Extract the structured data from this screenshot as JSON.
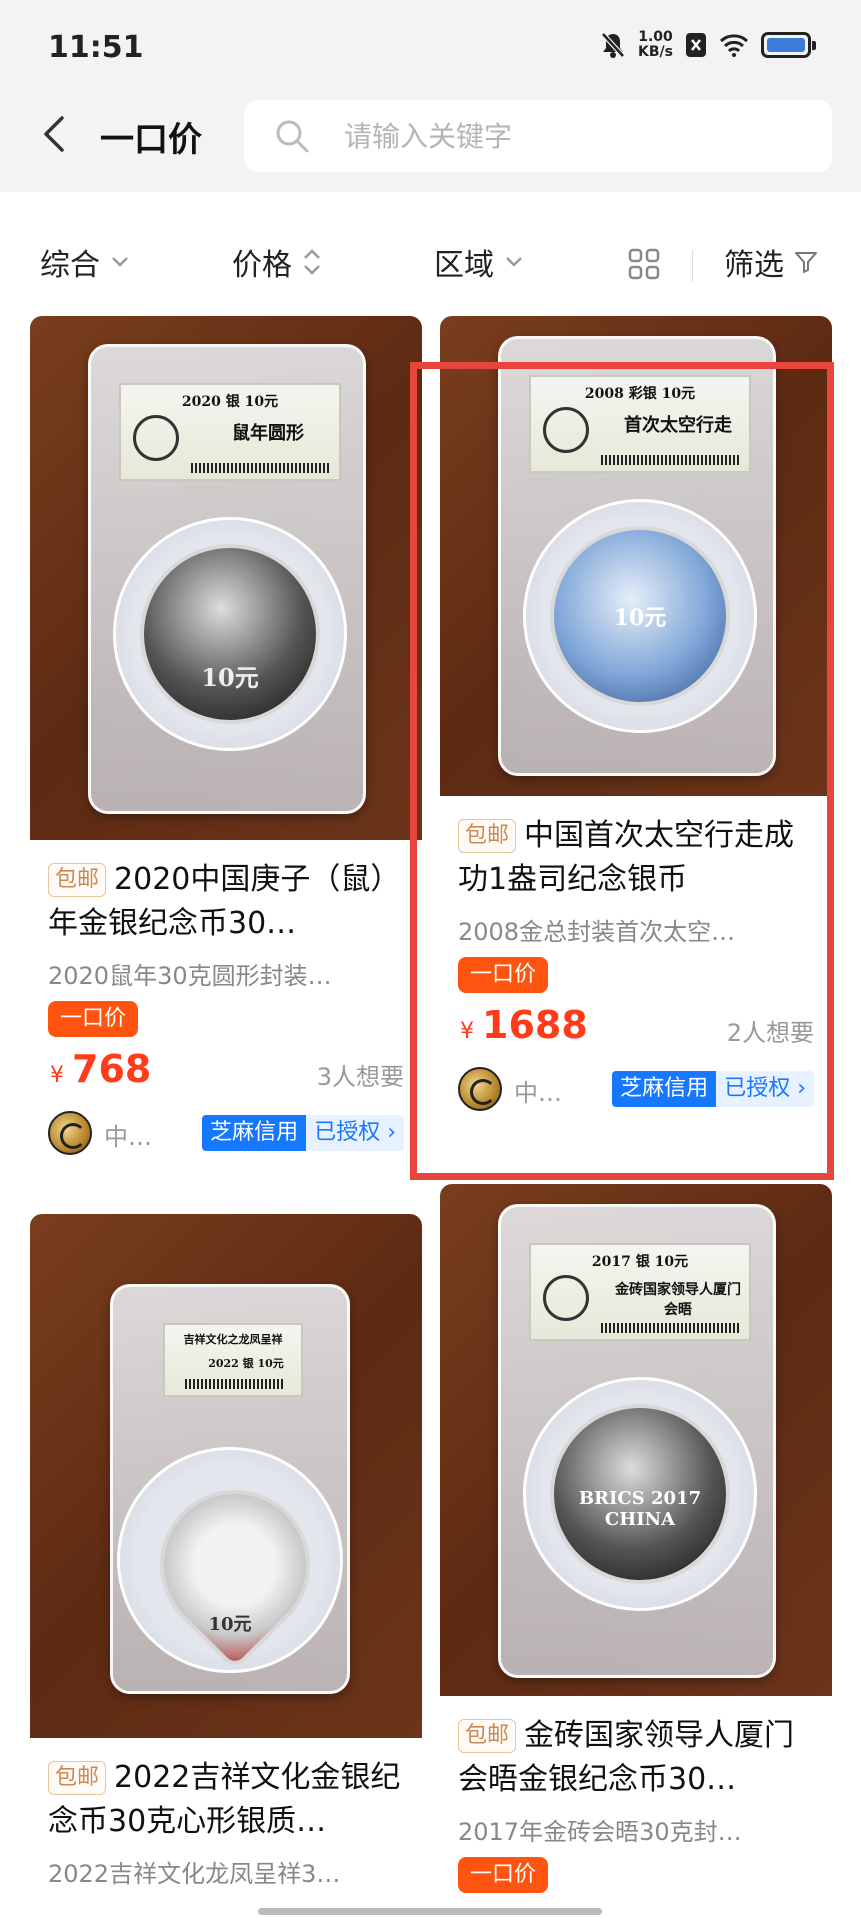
{
  "status_bar": {
    "time": "11:51",
    "speed_value": "1.00",
    "speed_unit": "KB/s"
  },
  "header": {
    "title": "一口价",
    "search_placeholder": "请输入关键字"
  },
  "filters": {
    "sort": "综合",
    "price": "价格",
    "region": "区域",
    "filter": "筛选"
  },
  "colors": {
    "accent": "#ff3c1a",
    "fixed_tag": "#ff5310",
    "credit": "#1677ff",
    "highlight": "#e8453c"
  },
  "products": [
    {
      "tag": "包邮",
      "title": "2020中国庚子（鼠）年金银纪念币30…",
      "subtitle": "2020鼠年30克圆形封装…",
      "fixed_price_tag": "一口价",
      "currency": "¥",
      "price": "768",
      "wants": "3人想要",
      "seller": "中…",
      "credit_name": "芝麻信用",
      "credit_status": "已授权",
      "slab_year_line": "2020    银    10元",
      "slab_name": "鼠年圆形",
      "coin_text": "10元"
    },
    {
      "tag": "包邮",
      "title": "中国首次太空行走成功1盎司纪念银币",
      "subtitle": "2008金总封装首次太空…",
      "fixed_price_tag": "一口价",
      "currency": "¥",
      "price": "1688",
      "wants": "2人想要",
      "seller": "中…",
      "credit_name": "芝麻信用",
      "credit_status": "已授权",
      "slab_year_line": "2008  彩银  10元",
      "slab_name": "首次太空行走",
      "coin_text": "10元"
    },
    {
      "tag": "包邮",
      "title": "2022吉祥文化金银纪念币30克心形银质…",
      "subtitle": "2022吉祥文化龙凤呈祥3…",
      "slab_year_line": "吉祥文化之龙凤呈祥",
      "slab_name": "2022  银  10元",
      "coin_text": "10元"
    },
    {
      "tag": "包邮",
      "title": "金砖国家领导人厦门会晤金银纪念币30…",
      "subtitle": "2017年金砖会晤30克封…",
      "fixed_price_tag": "一口价",
      "slab_year_line": "2017    银    10元",
      "slab_name": "金砖国家领导人厦门会晤",
      "coin_text": "BRICS 2017 CHINA"
    }
  ]
}
